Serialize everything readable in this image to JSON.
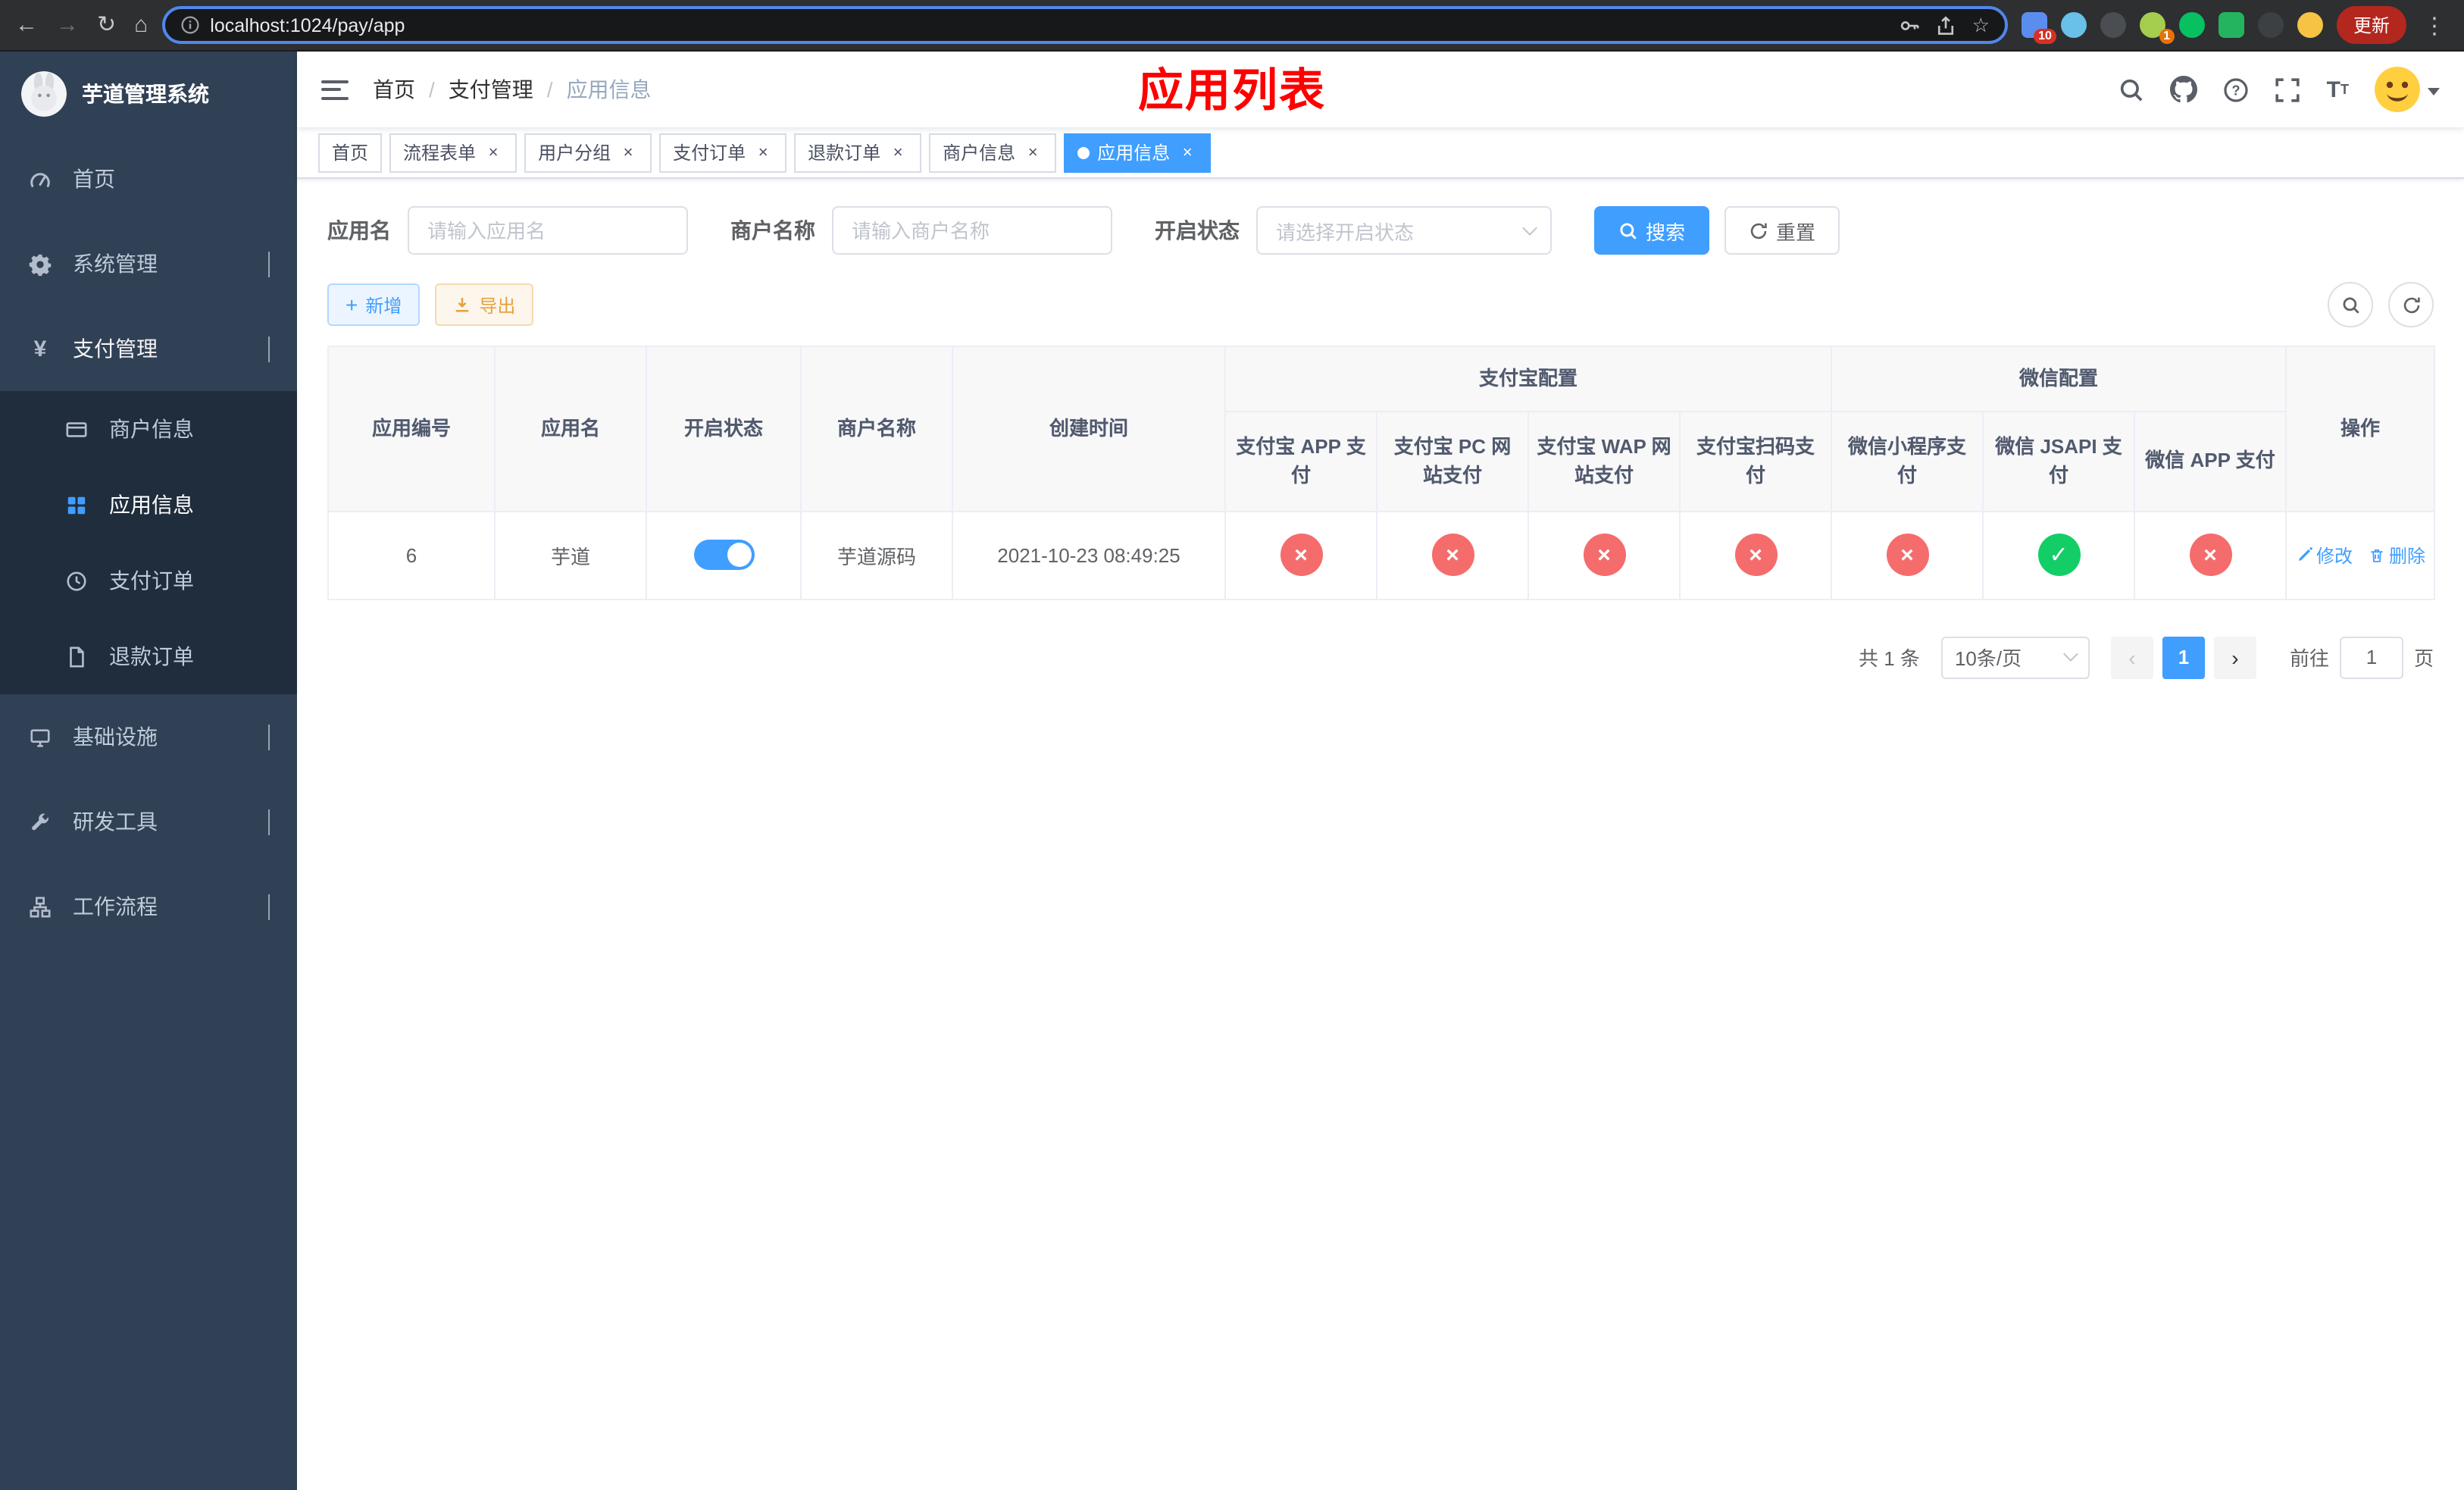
{
  "colors": {
    "accent": "#409eff",
    "danger": "#f56c6c",
    "success": "#13ce66",
    "warning": "#e6a23c",
    "title": "#ff0000"
  },
  "browser": {
    "url": "localhost:1024/pay/app",
    "update_label": "更新",
    "badge_extensions": "10",
    "badge_profile": "1"
  },
  "page_title": "应用列表",
  "sidebar": {
    "logo_text": "芋道管理系统",
    "items": [
      {
        "label": "首页"
      },
      {
        "label": "系统管理"
      },
      {
        "label": "支付管理"
      },
      {
        "label": "商户信息"
      },
      {
        "label": "应用信息"
      },
      {
        "label": "支付订单"
      },
      {
        "label": "退款订单"
      },
      {
        "label": "基础设施"
      },
      {
        "label": "研发工具"
      },
      {
        "label": "工作流程"
      }
    ]
  },
  "breadcrumb": {
    "items": [
      "首页",
      "支付管理",
      "应用信息"
    ]
  },
  "tabs": [
    {
      "label": "首页"
    },
    {
      "label": "流程表单"
    },
    {
      "label": "用户分组"
    },
    {
      "label": "支付订单"
    },
    {
      "label": "退款订单"
    },
    {
      "label": "商户信息"
    },
    {
      "label": "应用信息"
    }
  ],
  "filters": {
    "app_name_label": "应用名",
    "app_name_placeholder": "请输入应用名",
    "merchant_label": "商户名称",
    "merchant_placeholder": "请输入商户名称",
    "status_label": "开启状态",
    "status_placeholder": "请选择开启状态",
    "search_label": "搜索",
    "reset_label": "重置"
  },
  "toolbar": {
    "add_label": "新增",
    "export_label": "导出"
  },
  "table": {
    "groups": {
      "alipay": "支付宝配置",
      "wechat": "微信配置"
    },
    "columns": [
      "应用编号",
      "应用名",
      "开启状态",
      "商户名称",
      "创建时间",
      "支付宝 APP 支付",
      "支付宝 PC 网站支付",
      "支付宝 WAP 网站支付",
      "支付宝扫码支付",
      "微信小程序支付",
      "微信 JSAPI 支付",
      "微信 APP 支付",
      "操作"
    ],
    "rows": [
      {
        "id": "6",
        "name": "芋道",
        "enabled": true,
        "merchant": "芋道源码",
        "created": "2021-10-23 08:49:25",
        "configs": [
          "error",
          "error",
          "error",
          "error",
          "error",
          "success",
          "error"
        ],
        "edit_label": "修改",
        "delete_label": "删除"
      }
    ]
  },
  "pagination": {
    "total": "共 1 条",
    "page_size": "10条/页",
    "current_page": "1",
    "goto_prefix": "前往",
    "goto_value": "1",
    "goto_suffix": "页"
  }
}
